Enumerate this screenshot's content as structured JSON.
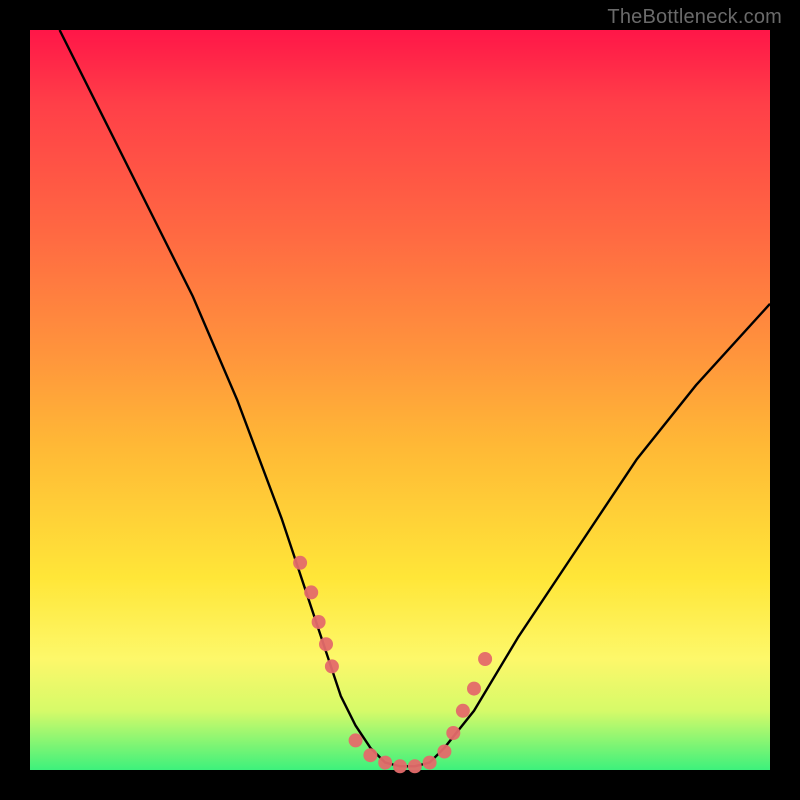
{
  "watermark": "TheBottleneck.com",
  "chart_data": {
    "type": "line",
    "title": "",
    "xlabel": "",
    "ylabel": "",
    "xlim": [
      0,
      100
    ],
    "ylim": [
      0,
      100
    ],
    "curve": {
      "x": [
        4,
        10,
        16,
        22,
        28,
        34,
        36,
        38,
        40,
        42,
        44,
        46,
        48,
        50,
        52,
        54,
        56,
        60,
        66,
        74,
        82,
        90,
        100
      ],
      "y": [
        100,
        88,
        76,
        64,
        50,
        34,
        28,
        22,
        16,
        10,
        6,
        3,
        1,
        0.5,
        0.5,
        1,
        3,
        8,
        18,
        30,
        42,
        52,
        63
      ]
    },
    "scatter": {
      "x": [
        36.5,
        38,
        39,
        40,
        40.8,
        44,
        46,
        48,
        50,
        52,
        54,
        56,
        57.2,
        58.5,
        60,
        61.5
      ],
      "y": [
        28,
        24,
        20,
        17,
        14,
        4,
        2,
        1,
        0.5,
        0.5,
        1,
        2.5,
        5,
        8,
        11,
        15
      ]
    },
    "colors": {
      "curve": "#000000",
      "dots": "#e46a6a",
      "gradient_top": "#ff1648",
      "gradient_bottom": "#3df17c",
      "frame": "#000000"
    }
  }
}
